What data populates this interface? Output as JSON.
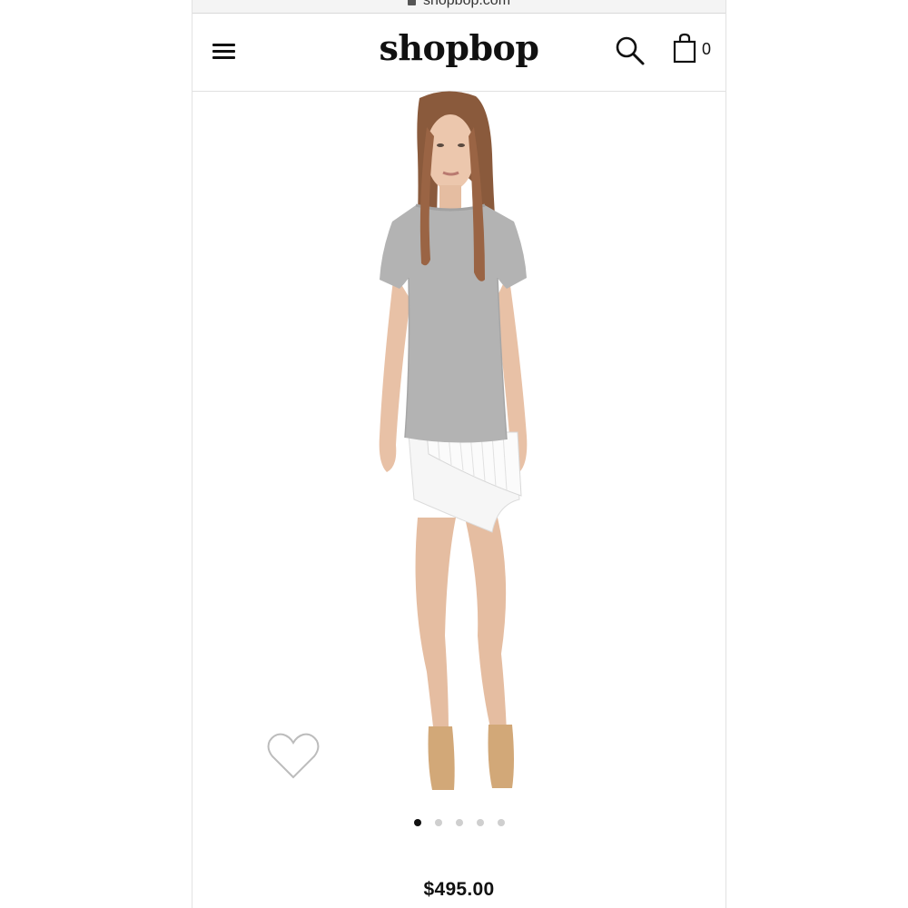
{
  "browser": {
    "url": "shopbop.com"
  },
  "header": {
    "logo": "shopbop",
    "cart_count": "0"
  },
  "product": {
    "price": "$495.00",
    "image_count": 5,
    "active_image_index": 0
  },
  "colors": {
    "text": "#111111",
    "divider": "#e0e0e0",
    "dot_inactive": "#cfcfcf",
    "dot_active": "#111111"
  },
  "icons": {
    "menu": "hamburger-icon",
    "search": "search-icon",
    "cart": "shopping-bag-icon",
    "wishlist": "heart-outline-icon"
  }
}
